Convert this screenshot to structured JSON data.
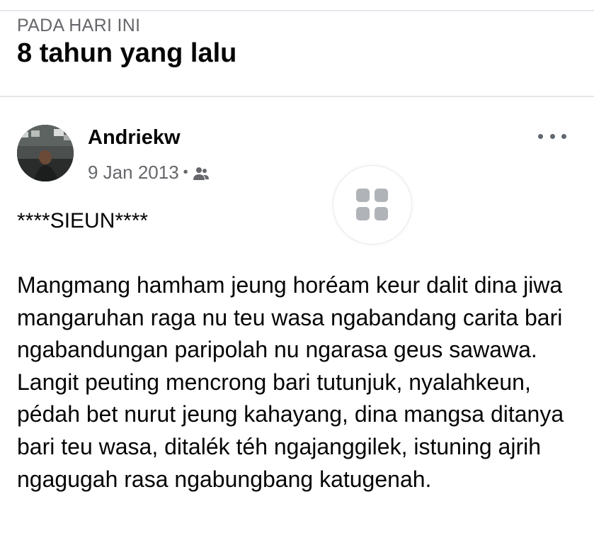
{
  "memories": {
    "section_label": "PADA HARI INI",
    "section_title": "8 tahun yang lalu"
  },
  "post": {
    "author": "Andriekw",
    "date": "9 Jan 2013",
    "separator": "•",
    "audience_icon": "friends-icon",
    "title": "****SIEUN****",
    "body": "Mangmang hamham jeung horéam keur dalit dina jiwa mangaruhan raga nu teu wasa ngabandang carita bari ngabandungan paripolah nu ngarasa geus sawawa. Langit peuting mencrong bari tutunjuk, nyalahkeun, pédah bet nurut jeung kahayang, dina mangsa ditanya bari teu wasa, ditalék téh ngajanggilek, istuning ajrih ngagugah rasa ngabungbang katugenah."
  },
  "icons": {
    "more": "more-dots-icon",
    "grid": "grid-icon"
  },
  "colors": {
    "primary_text": "#050505",
    "secondary_text": "#65676b",
    "divider": "#e4e6eb",
    "icon_gray": "#b0b3b8"
  }
}
